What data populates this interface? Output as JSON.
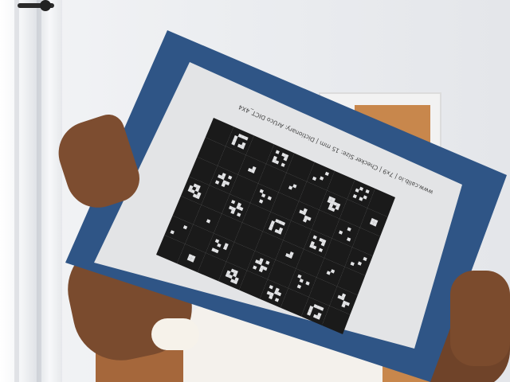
{
  "calibration_board": {
    "caption": "www.calib.io | 7x9 | Checker Size: 15 mm | Dictionary: ArUco DICT_4X4",
    "rows": 7,
    "cols": 9
  },
  "colors": {
    "backing_board": "#2f5586",
    "paper": "#e3e4e6",
    "checker": "#1a1a1a",
    "wall": "#eceef1",
    "door": "#c8874c",
    "skin": "#7a4b2e",
    "shirt": "#f4f1ec"
  }
}
